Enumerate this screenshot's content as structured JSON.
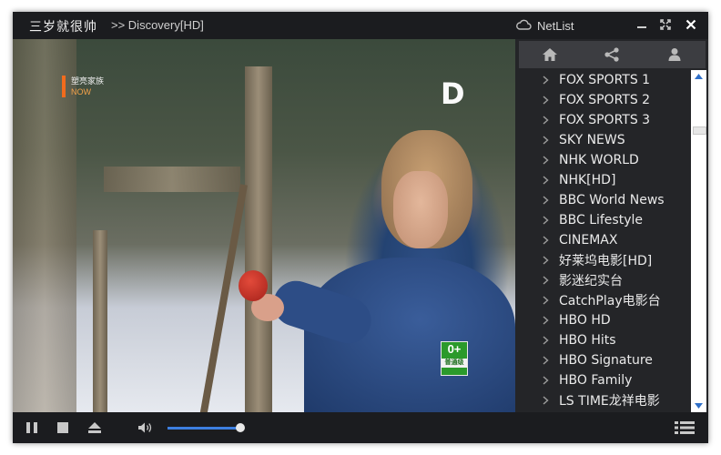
{
  "window": {
    "app_title": "三岁就很帅",
    "channel_title": ">> Discovery[HD]",
    "netlist_label": "NetList",
    "buttons": {
      "minimize": "minimize-icon",
      "maximize": "expand-icon",
      "close": "close-icon"
    }
  },
  "video": {
    "badge_line1": "塑亮家族",
    "badge_line2": "NOW",
    "channel_logo": "D",
    "rating_mark": "0+",
    "rating_text": "普通级"
  },
  "sidebar": {
    "icons": [
      "home-icon",
      "share-icon",
      "user-icon"
    ],
    "channels": [
      "FOX SPORTS 1",
      "FOX SPORTS 2",
      "FOX SPORTS 3",
      "SKY NEWS",
      "NHK WORLD",
      "NHK[HD]",
      "BBC World News",
      "BBC Lifestyle",
      "CINEMAX",
      "好莱坞电影[HD]",
      "影迷纪实台",
      "CatchPlay电影台",
      "HBO HD",
      "HBO Hits",
      "HBO Signature",
      "HBO Family",
      "LS TIME龙祥电影"
    ]
  },
  "controls": {
    "volume_level": 0.98,
    "icons": [
      "pause-icon",
      "stop-icon",
      "eject-icon",
      "volume-icon",
      "playlist-icon"
    ]
  },
  "colors": {
    "accent": "#3d7fe0",
    "badge_orange": "#f26b1d",
    "rating_green": "#2b9a2b"
  }
}
